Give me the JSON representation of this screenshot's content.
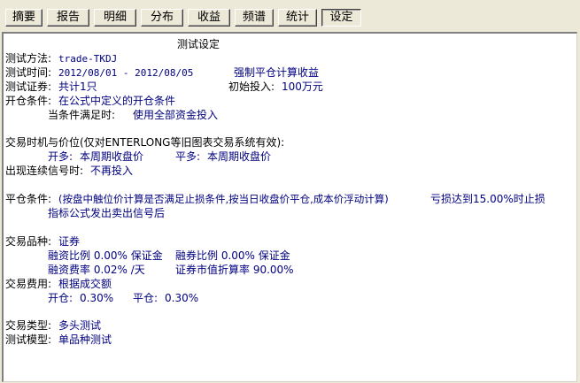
{
  "tabs": [
    "摘要",
    "报告",
    "明细",
    "分布",
    "收益",
    "频谱",
    "统计",
    "设定"
  ],
  "active_tab": "设定",
  "title": "测试设定",
  "method": {
    "label": "测试方法:",
    "value": "trade-TKDJ"
  },
  "time": {
    "label": "测试时间:",
    "value": "2012/08/01 - 2012/08/05",
    "extra": "强制平仓计算收益"
  },
  "securities": {
    "label": "测试证券:",
    "value": "共计1只",
    "init_label": "初始投入:",
    "init_value": "100万元"
  },
  "open_cond": {
    "label": "开仓条件:",
    "value": "在公式中定义的开仓条件"
  },
  "when_met": {
    "label": "当条件满足时:",
    "value": "使用全部资金投入"
  },
  "timing": {
    "label": "交易时机与价位(仅对ENTERLONG等旧图表交易系统有效):"
  },
  "open_price": {
    "label": "开多:",
    "value": "本周期收盘价"
  },
  "close_price": {
    "label": "平多:",
    "value": "本周期收盘价"
  },
  "consecutive": {
    "label": "出现连续信号时:",
    "value": "不再投入"
  },
  "close_cond": {
    "label": "平仓条件:",
    "value": "(按盘中触位价计算是否满足止损条件,按当日收盘价平仓,成本价浮动计算)",
    "stop": "亏损达到15.00%时止损"
  },
  "close_formula": "指标公式发出卖出信号后",
  "variety": {
    "label": "交易品种:",
    "value": "证券"
  },
  "margin1": {
    "a": "融资比例 0.00% 保证金",
    "b": "融券比例 0.00% 保证金"
  },
  "margin2": {
    "a": "融资费率 0.02% /天",
    "b": "证券市值折算率 90.00%"
  },
  "fee": {
    "label": "交易费用:",
    "value": "根据成交额"
  },
  "fee_detail": {
    "open_label": "开仓:",
    "open": "0.30%",
    "close_label": "平仓:",
    "close": "0.30%"
  },
  "trade_type": {
    "label": "交易类型:",
    "value": "多头测试"
  },
  "model": {
    "label": "测试模型:",
    "value": "单品种测试"
  }
}
